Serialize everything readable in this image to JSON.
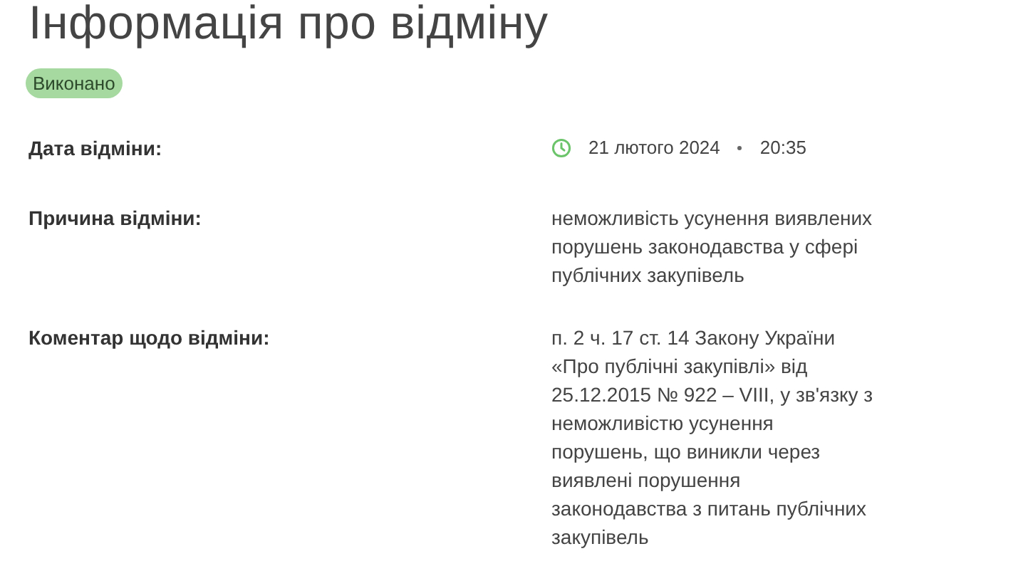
{
  "title": "Інформація про відміну",
  "status": {
    "label": "Виконано",
    "kind": "done"
  },
  "rows": [
    {
      "label": "Дата відміни:",
      "kind": "datetime",
      "date": "21 лютого 2024",
      "time": "20:35"
    },
    {
      "label": "Причина відміни:",
      "kind": "text",
      "lines": [
        "неможливість усунення виявлених",
        "порушень законодавства у сфері",
        "публічних закупівель"
      ]
    },
    {
      "label": "Коментар щодо відміни:",
      "kind": "text",
      "lines": [
        "п. 2 ч. 17 ст. 14 Закону України",
        "«Про публічні закупівлі» від",
        "25.12.2015 № 922 – VIII, у зв'язку з",
        "неможливістю усунення",
        "порушень, що виникли через",
        "виявлені порушення",
        "законодавства з питань публічних",
        "закупівель"
      ]
    }
  ]
}
